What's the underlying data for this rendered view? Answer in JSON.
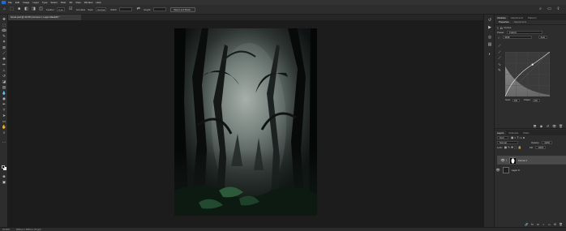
{
  "menu": [
    "File",
    "Edit",
    "Image",
    "Layer",
    "Type",
    "Select",
    "Filter",
    "3D",
    "View",
    "Window",
    "Help"
  ],
  "options_bar": {
    "feather_label": "Feather:",
    "feather_value": "0 px",
    "antialias_label": "Anti-alias",
    "style_label": "Style:",
    "style_value": "Normal",
    "width_label": "Width:",
    "height_label": "Height:",
    "select_mask_button": "Select and Mask..."
  },
  "document_tab": "forest.psd @ 33.3% (Curves 1, Layer Mask/8) *",
  "status": {
    "zoom": "33.33%",
    "doc_info": "1920 px x 2560 px (72 ppi)"
  },
  "panel_tabs": [
    "Libraries",
    "Adjustments",
    "Patterns"
  ],
  "properties": {
    "tabs": [
      "Properties",
      "Adjustments"
    ],
    "adjustment_name": "Curves",
    "preset_label": "Preset:",
    "preset_value": "Custom",
    "channel_value": "RGB",
    "auto_button": "Auto",
    "input_label": "Input:",
    "input_value": "156",
    "output_label": "Output:",
    "output_value": "202"
  },
  "layers_panel": {
    "tabs": [
      "Layers",
      "Channels",
      "Paths"
    ],
    "kind_label": "Kind",
    "blend_mode": "Normal",
    "opacity_label": "Opacity:",
    "opacity_value": "100%",
    "lock_label": "Lock:",
    "fill_label": "Fill:",
    "fill_value": "100%",
    "layers": [
      {
        "name": "Curves 1"
      },
      {
        "name": "Layer 0"
      }
    ]
  },
  "colors": {
    "accent": "#1f6bd1",
    "foreground": "#000000",
    "background": "#ffffff"
  }
}
